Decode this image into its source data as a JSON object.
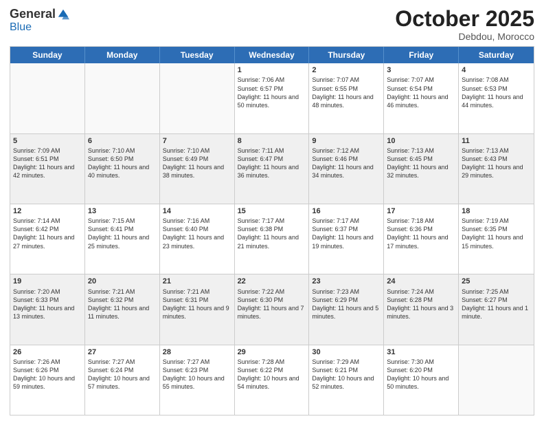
{
  "header": {
    "logo_general": "General",
    "logo_blue": "Blue",
    "month_title": "October 2025",
    "subtitle": "Debdou, Morocco"
  },
  "days_of_week": [
    "Sunday",
    "Monday",
    "Tuesday",
    "Wednesday",
    "Thursday",
    "Friday",
    "Saturday"
  ],
  "weeks": [
    [
      {
        "day": "",
        "info": "",
        "empty": true
      },
      {
        "day": "",
        "info": "",
        "empty": true
      },
      {
        "day": "",
        "info": "",
        "empty": true
      },
      {
        "day": "1",
        "info": "Sunrise: 7:06 AM\nSunset: 6:57 PM\nDaylight: 11 hours and 50 minutes."
      },
      {
        "day": "2",
        "info": "Sunrise: 7:07 AM\nSunset: 6:55 PM\nDaylight: 11 hours and 48 minutes."
      },
      {
        "day": "3",
        "info": "Sunrise: 7:07 AM\nSunset: 6:54 PM\nDaylight: 11 hours and 46 minutes."
      },
      {
        "day": "4",
        "info": "Sunrise: 7:08 AM\nSunset: 6:53 PM\nDaylight: 11 hours and 44 minutes."
      }
    ],
    [
      {
        "day": "5",
        "info": "Sunrise: 7:09 AM\nSunset: 6:51 PM\nDaylight: 11 hours and 42 minutes."
      },
      {
        "day": "6",
        "info": "Sunrise: 7:10 AM\nSunset: 6:50 PM\nDaylight: 11 hours and 40 minutes."
      },
      {
        "day": "7",
        "info": "Sunrise: 7:10 AM\nSunset: 6:49 PM\nDaylight: 11 hours and 38 minutes."
      },
      {
        "day": "8",
        "info": "Sunrise: 7:11 AM\nSunset: 6:47 PM\nDaylight: 11 hours and 36 minutes."
      },
      {
        "day": "9",
        "info": "Sunrise: 7:12 AM\nSunset: 6:46 PM\nDaylight: 11 hours and 34 minutes."
      },
      {
        "day": "10",
        "info": "Sunrise: 7:13 AM\nSunset: 6:45 PM\nDaylight: 11 hours and 32 minutes."
      },
      {
        "day": "11",
        "info": "Sunrise: 7:13 AM\nSunset: 6:43 PM\nDaylight: 11 hours and 29 minutes."
      }
    ],
    [
      {
        "day": "12",
        "info": "Sunrise: 7:14 AM\nSunset: 6:42 PM\nDaylight: 11 hours and 27 minutes."
      },
      {
        "day": "13",
        "info": "Sunrise: 7:15 AM\nSunset: 6:41 PM\nDaylight: 11 hours and 25 minutes."
      },
      {
        "day": "14",
        "info": "Sunrise: 7:16 AM\nSunset: 6:40 PM\nDaylight: 11 hours and 23 minutes."
      },
      {
        "day": "15",
        "info": "Sunrise: 7:17 AM\nSunset: 6:38 PM\nDaylight: 11 hours and 21 minutes."
      },
      {
        "day": "16",
        "info": "Sunrise: 7:17 AM\nSunset: 6:37 PM\nDaylight: 11 hours and 19 minutes."
      },
      {
        "day": "17",
        "info": "Sunrise: 7:18 AM\nSunset: 6:36 PM\nDaylight: 11 hours and 17 minutes."
      },
      {
        "day": "18",
        "info": "Sunrise: 7:19 AM\nSunset: 6:35 PM\nDaylight: 11 hours and 15 minutes."
      }
    ],
    [
      {
        "day": "19",
        "info": "Sunrise: 7:20 AM\nSunset: 6:33 PM\nDaylight: 11 hours and 13 minutes."
      },
      {
        "day": "20",
        "info": "Sunrise: 7:21 AM\nSunset: 6:32 PM\nDaylight: 11 hours and 11 minutes."
      },
      {
        "day": "21",
        "info": "Sunrise: 7:21 AM\nSunset: 6:31 PM\nDaylight: 11 hours and 9 minutes."
      },
      {
        "day": "22",
        "info": "Sunrise: 7:22 AM\nSunset: 6:30 PM\nDaylight: 11 hours and 7 minutes."
      },
      {
        "day": "23",
        "info": "Sunrise: 7:23 AM\nSunset: 6:29 PM\nDaylight: 11 hours and 5 minutes."
      },
      {
        "day": "24",
        "info": "Sunrise: 7:24 AM\nSunset: 6:28 PM\nDaylight: 11 hours and 3 minutes."
      },
      {
        "day": "25",
        "info": "Sunrise: 7:25 AM\nSunset: 6:27 PM\nDaylight: 11 hours and 1 minute."
      }
    ],
    [
      {
        "day": "26",
        "info": "Sunrise: 7:26 AM\nSunset: 6:26 PM\nDaylight: 10 hours and 59 minutes."
      },
      {
        "day": "27",
        "info": "Sunrise: 7:27 AM\nSunset: 6:24 PM\nDaylight: 10 hours and 57 minutes."
      },
      {
        "day": "28",
        "info": "Sunrise: 7:27 AM\nSunset: 6:23 PM\nDaylight: 10 hours and 55 minutes."
      },
      {
        "day": "29",
        "info": "Sunrise: 7:28 AM\nSunset: 6:22 PM\nDaylight: 10 hours and 54 minutes."
      },
      {
        "day": "30",
        "info": "Sunrise: 7:29 AM\nSunset: 6:21 PM\nDaylight: 10 hours and 52 minutes."
      },
      {
        "day": "31",
        "info": "Sunrise: 7:30 AM\nSunset: 6:20 PM\nDaylight: 10 hours and 50 minutes."
      },
      {
        "day": "",
        "info": "",
        "empty": true
      }
    ]
  ]
}
